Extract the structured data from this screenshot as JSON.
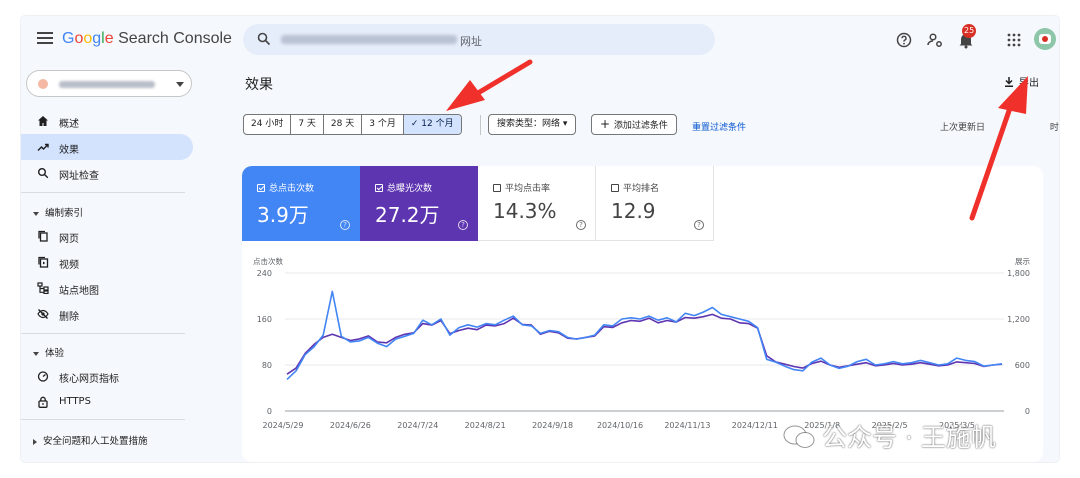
{
  "app": {
    "logo": {
      "google": "Google",
      "product": "Search Console"
    },
    "search": {
      "url_suffix": "网址"
    },
    "notifications_count": "25"
  },
  "sidebar": {
    "items": [
      {
        "label": "概述",
        "icon": "home-icon"
      },
      {
        "label": "效果",
        "icon": "trending-up-icon",
        "active": true
      },
      {
        "label": "网址检查",
        "icon": "search-icon"
      }
    ],
    "index_section": {
      "title": "编制索引",
      "items": [
        {
          "label": "网页",
          "icon": "pages-icon"
        },
        {
          "label": "视频",
          "icon": "video-icon"
        },
        {
          "label": "站点地图",
          "icon": "sitemap-icon"
        },
        {
          "label": "删除",
          "icon": "removals-icon"
        }
      ]
    },
    "experience_section": {
      "title": "体验",
      "items": [
        {
          "label": "核心网页指标",
          "icon": "gauge-icon"
        },
        {
          "label": "HTTPS",
          "icon": "lock-icon"
        }
      ]
    },
    "security_section": {
      "title": "安全问题和人工处置措施"
    }
  },
  "main": {
    "title": "效果",
    "export_label": "导出",
    "ranges": [
      "24 小时",
      "7 天",
      "28 天",
      "3 个月",
      "12 个月"
    ],
    "selected_range": "12 个月",
    "search_type_chip": "搜索类型：网络",
    "add_filter_label": "添加过滤条件",
    "reset_label": "重置过滤条件",
    "last_update_label": "上次更新日",
    "last_update_suffix": "时前"
  },
  "metrics": [
    {
      "label": "总点击次数",
      "value": "3.9万",
      "checked": true,
      "color": "#4285f4"
    },
    {
      "label": "总曝光次数",
      "value": "27.2万",
      "checked": true,
      "color": "#5e35b1"
    },
    {
      "label": "平均点击率",
      "value": "14.3%",
      "checked": false
    },
    {
      "label": "平均排名",
      "value": "12.9",
      "checked": false
    }
  ],
  "chart_data": {
    "type": "line",
    "y_left_label": "点击次数",
    "y_right_label": "展示",
    "y_left_ticks": [
      "240",
      "160",
      "80",
      "0"
    ],
    "y_right_ticks": [
      "1,800",
      "1,200",
      "600",
      "0"
    ],
    "ylim_left": [
      0,
      240
    ],
    "ylim_right": [
      0,
      1800
    ],
    "x_ticks": [
      "2024/5/29",
      "2024/6/26",
      "2024/7/24",
      "2024/8/21",
      "2024/9/18",
      "2024/10/16",
      "2024/11/13",
      "2024/12/11",
      "2025/1/8",
      "2025/2/5",
      "2025/3/5"
    ],
    "series": [
      {
        "name": "总点击次数",
        "axis": "left",
        "color": "#4285f4",
        "values": [
          55,
          70,
          98,
          112,
          132,
          208,
          130,
          120,
          122,
          128,
          118,
          112,
          125,
          130,
          135,
          158,
          150,
          160,
          132,
          145,
          150,
          146,
          152,
          150,
          158,
          165,
          150,
          148,
          135,
          140,
          138,
          128,
          125,
          128,
          132,
          150,
          148,
          160,
          162,
          160,
          165,
          158,
          162,
          155,
          170,
          166,
          172,
          180,
          168,
          164,
          160,
          156,
          145,
          90,
          85,
          78,
          72,
          70,
          85,
          92,
          80,
          74,
          78,
          86,
          90,
          80,
          82,
          86,
          82,
          84,
          88,
          84,
          80,
          82,
          92,
          88,
          86,
          78,
          80,
          82
        ]
      },
      {
        "name": "总曝光次数",
        "axis": "right",
        "color": "#5e35b1",
        "values": [
          480,
          560,
          750,
          870,
          960,
          1000,
          960,
          920,
          940,
          980,
          900,
          890,
          960,
          1000,
          1020,
          1140,
          1120,
          1180,
          1010,
          1050,
          1080,
          1060,
          1120,
          1110,
          1140,
          1210,
          1130,
          1120,
          1000,
          1040,
          1020,
          950,
          940,
          960,
          980,
          1100,
          1090,
          1150,
          1180,
          1170,
          1210,
          1150,
          1180,
          1160,
          1220,
          1210,
          1230,
          1260,
          1210,
          1200,
          1150,
          1140,
          1080,
          720,
          640,
          610,
          580,
          560,
          620,
          650,
          600,
          570,
          590,
          610,
          630,
          590,
          600,
          620,
          600,
          610,
          630,
          610,
          590,
          600,
          640,
          630,
          620,
          580,
          600,
          610
        ]
      }
    ]
  },
  "watermark": "公众号 · 王施帆",
  "colors": {
    "accent": "#0b57d0",
    "selection": "#d3e3fd",
    "arrow": "#f0302a"
  }
}
